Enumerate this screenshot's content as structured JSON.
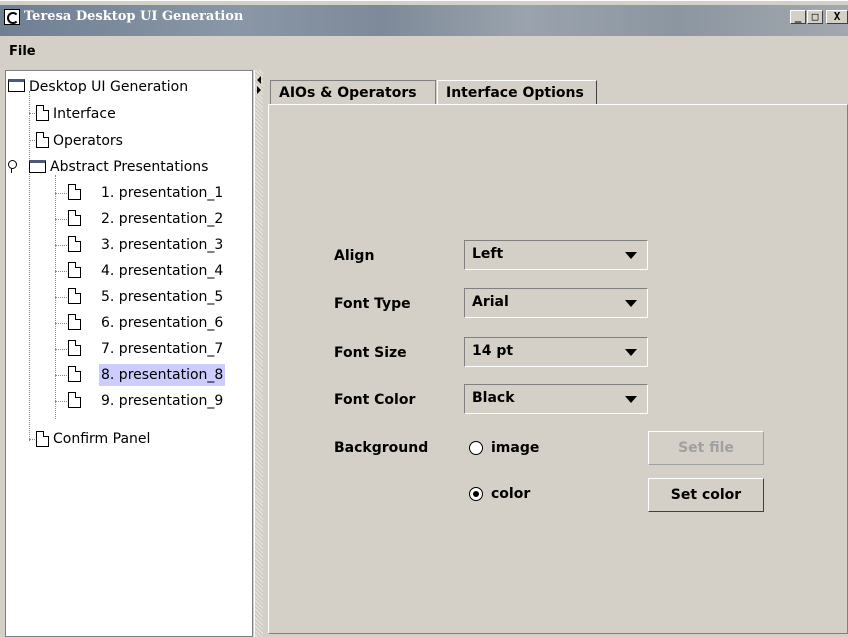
{
  "window": {
    "title": "Teresa Desktop UI Generation",
    "minimize": "_",
    "maximize": "□",
    "close": "X"
  },
  "menu": {
    "file": "File"
  },
  "tree": {
    "root": "Desktop UI Generation",
    "interface": "Interface",
    "operators": "Operators",
    "abstract": "Abstract Presentations",
    "presentations": [
      "1. presentation_1",
      "2. presentation_2",
      "3. presentation_3",
      "4. presentation_4",
      "5. presentation_5",
      "6. presentation_6",
      "7. presentation_7",
      "8. presentation_8",
      "9. presentation_9"
    ],
    "selected_index": 7,
    "confirm": "Confirm Panel"
  },
  "tabs": {
    "aios": "AIOs & Operators",
    "interface_options": "Interface Options"
  },
  "form": {
    "align": {
      "label": "Align",
      "value": "Left"
    },
    "font_type": {
      "label": "Font Type",
      "value": "Arial"
    },
    "font_size": {
      "label": "Font Size",
      "value": "14 pt"
    },
    "font_color": {
      "label": "Font Color",
      "value": "Black"
    },
    "background": {
      "label": "Background",
      "image_option": "image",
      "color_option": "color",
      "selected": "color"
    },
    "set_file": "Set file",
    "set_color": "Set color"
  },
  "colors": {
    "selection": "#ccccff",
    "chrome": "#d4d0c8"
  }
}
